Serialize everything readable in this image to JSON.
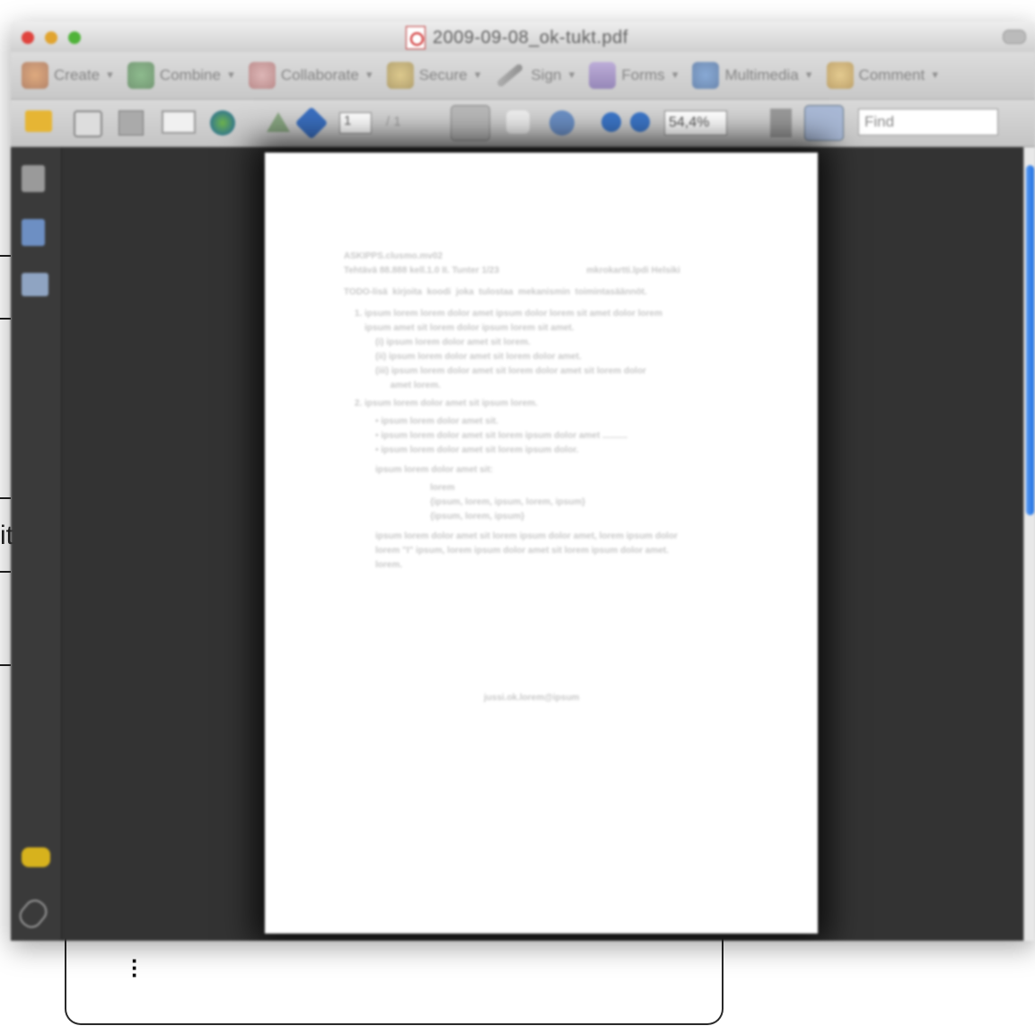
{
  "window": {
    "title": "2009-09-08_ok-tukt.pdf",
    "colors": {
      "close": "#e0443e",
      "minimize": "#e1a42f",
      "zoom": "#50b33a"
    }
  },
  "toolbar_main": {
    "items": [
      {
        "label": "Create",
        "icon": "create-icon"
      },
      {
        "label": "Combine",
        "icon": "combine-icon"
      },
      {
        "label": "Collaborate",
        "icon": "collaborate-icon"
      },
      {
        "label": "Secure",
        "icon": "lock-icon"
      },
      {
        "label": "Sign",
        "icon": "pen-icon"
      },
      {
        "label": "Forms",
        "icon": "forms-icon"
      },
      {
        "label": "Multimedia",
        "icon": "multimedia-icon"
      },
      {
        "label": "Comment",
        "icon": "comment-icon"
      }
    ]
  },
  "toolbar_nav": {
    "page_number": "1",
    "page_total": "/ 1",
    "zoom_level": "54,4%",
    "find_placeholder": "Find"
  },
  "document": {
    "lines": [
      "ASKIPPS.clusmo.mv02\nTehtävä 88.888 kell.1.0 II. Tunter 1/23                                   mkrokartti.lpdi Helsiki",
      "TODO-lisä  kirjoita  koodi  joka  tulostaa  mekanismin  toimintasäännöt.",
      "1. ipsum lorem lorem dolor amet ipsum dolor lorem sit amet dolor lorem\n    ipsum amet sit lorem dolor ipsum lorem sit amet.",
      "    (i) ipsum lorem dolor amet sit lorem.\n    (ii) ipsum lorem dolor amet sit lorem dolor amet.\n    (iii) ipsum lorem dolor amet sit lorem dolor amet sit lorem dolor\n          amet lorem.",
      "2. ipsum lorem dolor amet sit ipsum lorem.",
      "    • ipsum lorem dolor amet sit.\n    • ipsum lorem dolor amet sit lorem ipsum dolor amet ..........\n    • ipsum lorem dolor amet sit lorem ipsum dolor.",
      "    ipsum lorem dolor amet sit:",
      "                          lorem\n                          {ipsum, lorem, ipsum, lorem, ipsum}\n                          {ipsum, lorem, ipsum}",
      "    ipsum lorem dolor amet sit lorem ipsum dolor amet, lorem ipsum dolor\n    lorem \"I\" ipsum, lorem ipsum dolor amet sit lorem ipsum dolor amet.\n    lorem.",
      "jussi.ok.lorem@ipsum"
    ]
  }
}
